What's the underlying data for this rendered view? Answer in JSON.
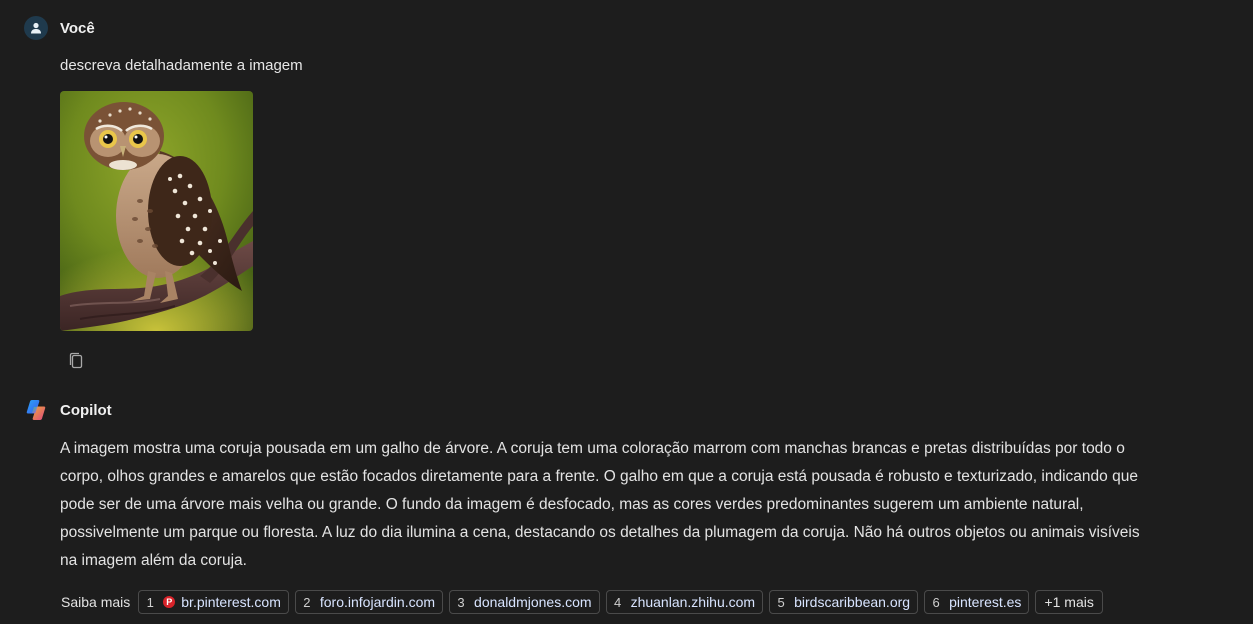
{
  "user_message": {
    "author": "Você",
    "text": "descreva detalhadamente a imagem",
    "avatar_icon": "person-icon",
    "attachment": "owl-photo"
  },
  "copilot_message": {
    "author": "Copilot",
    "avatar_icon": "copilot-logo-icon",
    "text": "A imagem mostra uma coruja pousada em um galho de árvore. A coruja tem uma coloração marrom com manchas brancas e pretas distribuídas por todo o corpo, olhos grandes e amarelos que estão focados diretamente para a frente. O galho em que a coruja está pousada é robusto e texturizado, indicando que pode ser de uma árvore mais velha ou grande. O fundo da imagem é desfocado, mas as cores verdes predominantes sugerem um ambiente natural, possivelmente um parque ou floresta. A luz do dia ilumina a cena, destacando os detalhes da plumagem da coruja. Não há outros objetos ou animais visíveis na imagem além da coruja."
  },
  "learn_more": {
    "label": "Saiba mais",
    "sources": [
      {
        "num": "1",
        "domain": "br.pinterest.com"
      },
      {
        "num": "2",
        "domain": "foro.infojardin.com"
      },
      {
        "num": "3",
        "domain": "donaldmjones.com"
      },
      {
        "num": "4",
        "domain": "zhuanlan.zhihu.com"
      },
      {
        "num": "5",
        "domain": "birdscaribbean.org"
      },
      {
        "num": "6",
        "domain": "pinterest.es"
      }
    ],
    "more_label": "+1 mais"
  },
  "colors": {
    "background": "#1d1d1d",
    "chip_border": "#4a4a4a",
    "link_text": "#d8e4ff"
  }
}
